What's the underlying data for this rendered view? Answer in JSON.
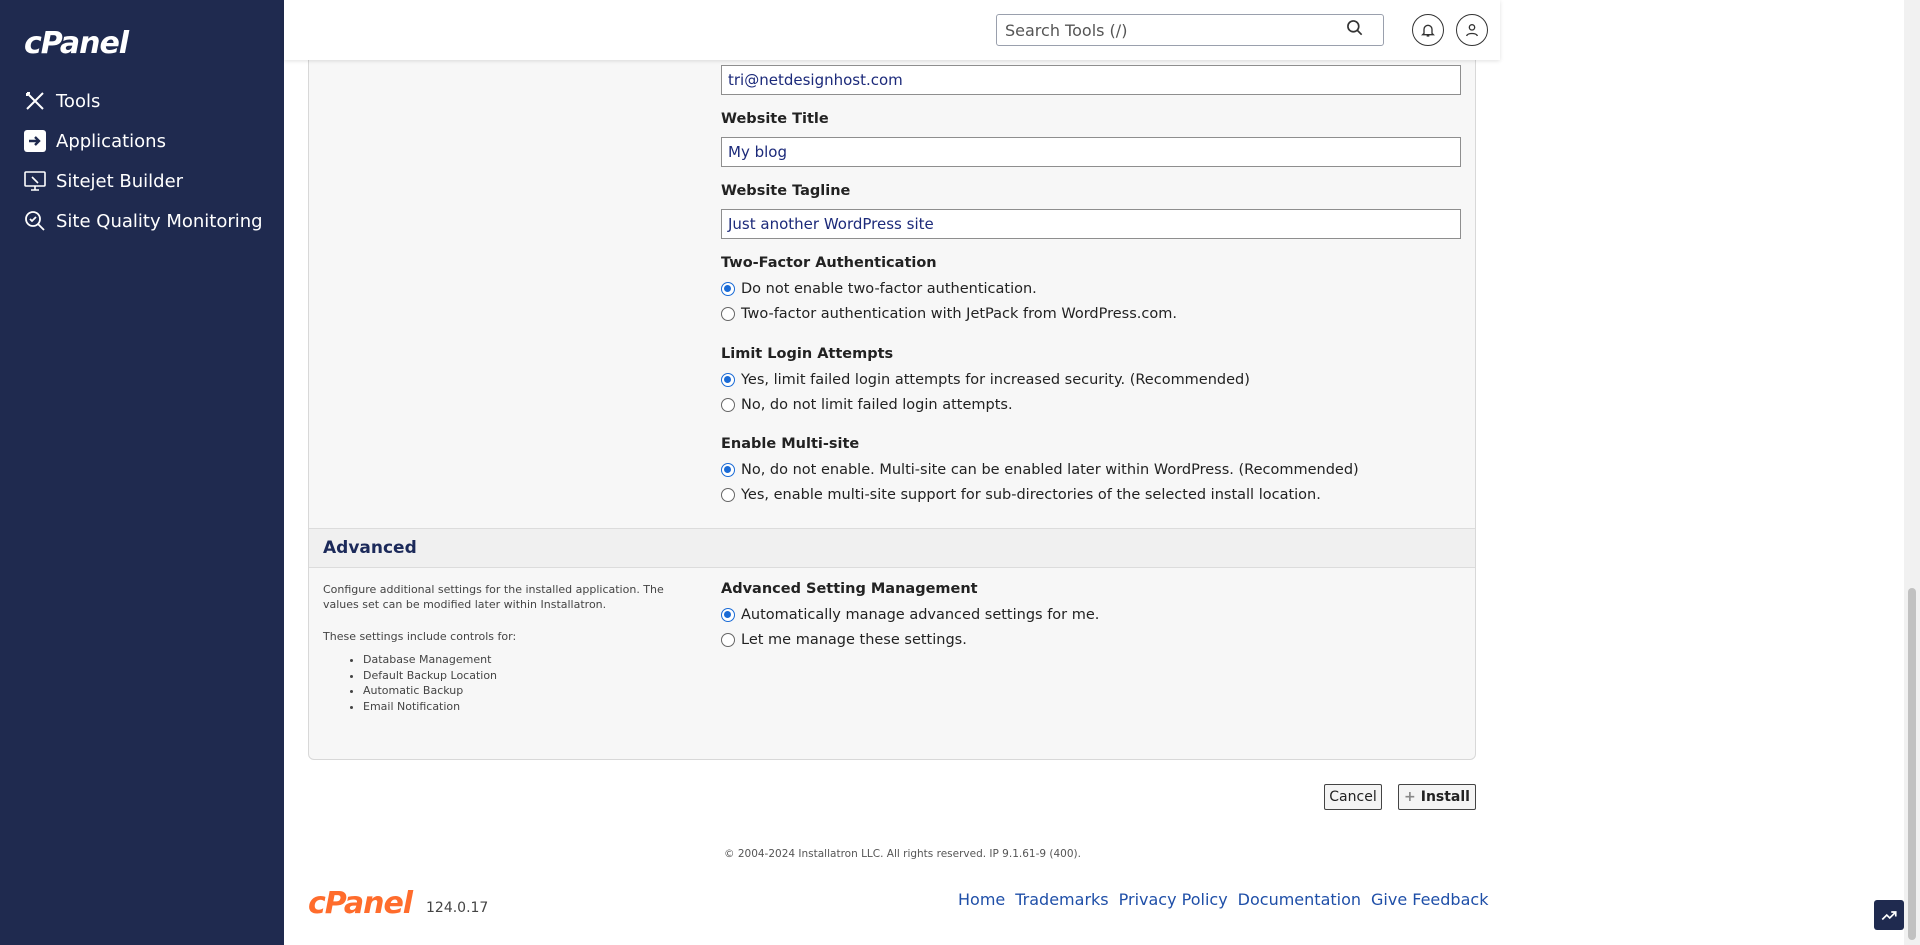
{
  "sidebar": {
    "brand": "cPanel",
    "items": [
      {
        "label": "Tools",
        "icon": "tools-icon"
      },
      {
        "label": "Applications",
        "icon": "applications-icon"
      },
      {
        "label": "Sitejet Builder",
        "icon": "sitejet-icon"
      },
      {
        "label": "Site Quality Monitoring",
        "icon": "site-quality-icon"
      }
    ]
  },
  "header": {
    "search_placeholder": "Search Tools (/)"
  },
  "form": {
    "email_value": "tri@netdesignhost.com",
    "website_title_label": "Website Title",
    "website_title_value": "My blog",
    "website_tagline_label": "Website Tagline",
    "website_tagline_value": "Just another WordPress site",
    "two_factor": {
      "label": "Two-Factor Authentication",
      "options": [
        {
          "label": "Do not enable two-factor authentication.",
          "checked": true
        },
        {
          "label": "Two-factor authentication with JetPack from WordPress.com.",
          "checked": false
        }
      ]
    },
    "limit_login": {
      "label": "Limit Login Attempts",
      "options": [
        {
          "label": "Yes, limit failed login attempts for increased security. (Recommended)",
          "checked": true
        },
        {
          "label": "No, do not limit failed login attempts.",
          "checked": false
        }
      ]
    },
    "multisite": {
      "label": "Enable Multi-site",
      "options": [
        {
          "label": "No, do not enable. Multi-site can be enabled later within WordPress. (Recommended)",
          "checked": true
        },
        {
          "label": "Yes, enable multi-site support for sub-directories of the selected install location.",
          "checked": false
        }
      ]
    }
  },
  "advanced": {
    "title": "Advanced",
    "description": "Configure additional settings for the installed application. The values set can be modified later within Installatron.",
    "controls_intro": "These settings include controls for:",
    "controls": [
      "Database Management",
      "Default Backup Location",
      "Automatic Backup",
      "Email Notification"
    ],
    "management": {
      "label": "Advanced Setting Management",
      "options": [
        {
          "label": "Automatically manage advanced settings for me.",
          "checked": true
        },
        {
          "label": "Let me manage these settings.",
          "checked": false
        }
      ]
    }
  },
  "actions": {
    "cancel_label": "Cancel",
    "install_label": "Install"
  },
  "footer": {
    "copyright": "© 2004-2024 Installatron LLC. All rights reserved. IP 9.1.61-9 (400).",
    "logo": "cPanel",
    "version": "124.0.17",
    "links": [
      "Home",
      "Trademarks",
      "Privacy Policy",
      "Documentation",
      "Give Feedback"
    ]
  },
  "colors": {
    "sidebar_bg": "#1f2a4f",
    "accent": "#1a6bd6",
    "footer_logo": "#ff6c2c",
    "link": "#1f4fa8"
  }
}
